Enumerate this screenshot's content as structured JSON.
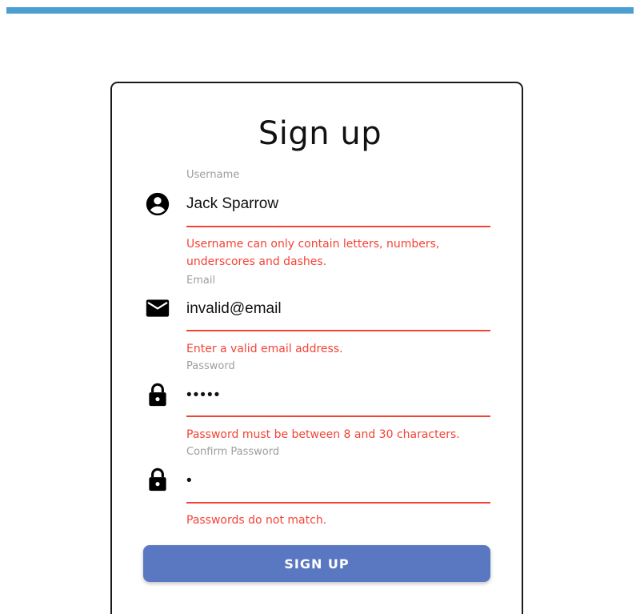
{
  "top_bar": {
    "color": "#4a9fd0"
  },
  "form": {
    "title": "Sign up",
    "accent_error_color": "#f44336",
    "fields": [
      {
        "label": "Username",
        "value": "Jack Sparrow",
        "icon": "account-circle-icon",
        "error": "Username can only contain letters, numbers, underscores and dashes."
      },
      {
        "label": "Email",
        "value": "invalid@email",
        "icon": "mail-icon",
        "error": "Enter a valid email address."
      },
      {
        "label": "Password",
        "value": "•••••",
        "icon": "lock-icon",
        "error": "Password must be between 8 and 30 characters."
      },
      {
        "label": "Confirm Password",
        "value": "•",
        "icon": "lock-icon",
        "error": "Passwords do not match."
      }
    ],
    "submit_label": "SIGN UP",
    "submit_color": "#5a78c2"
  }
}
